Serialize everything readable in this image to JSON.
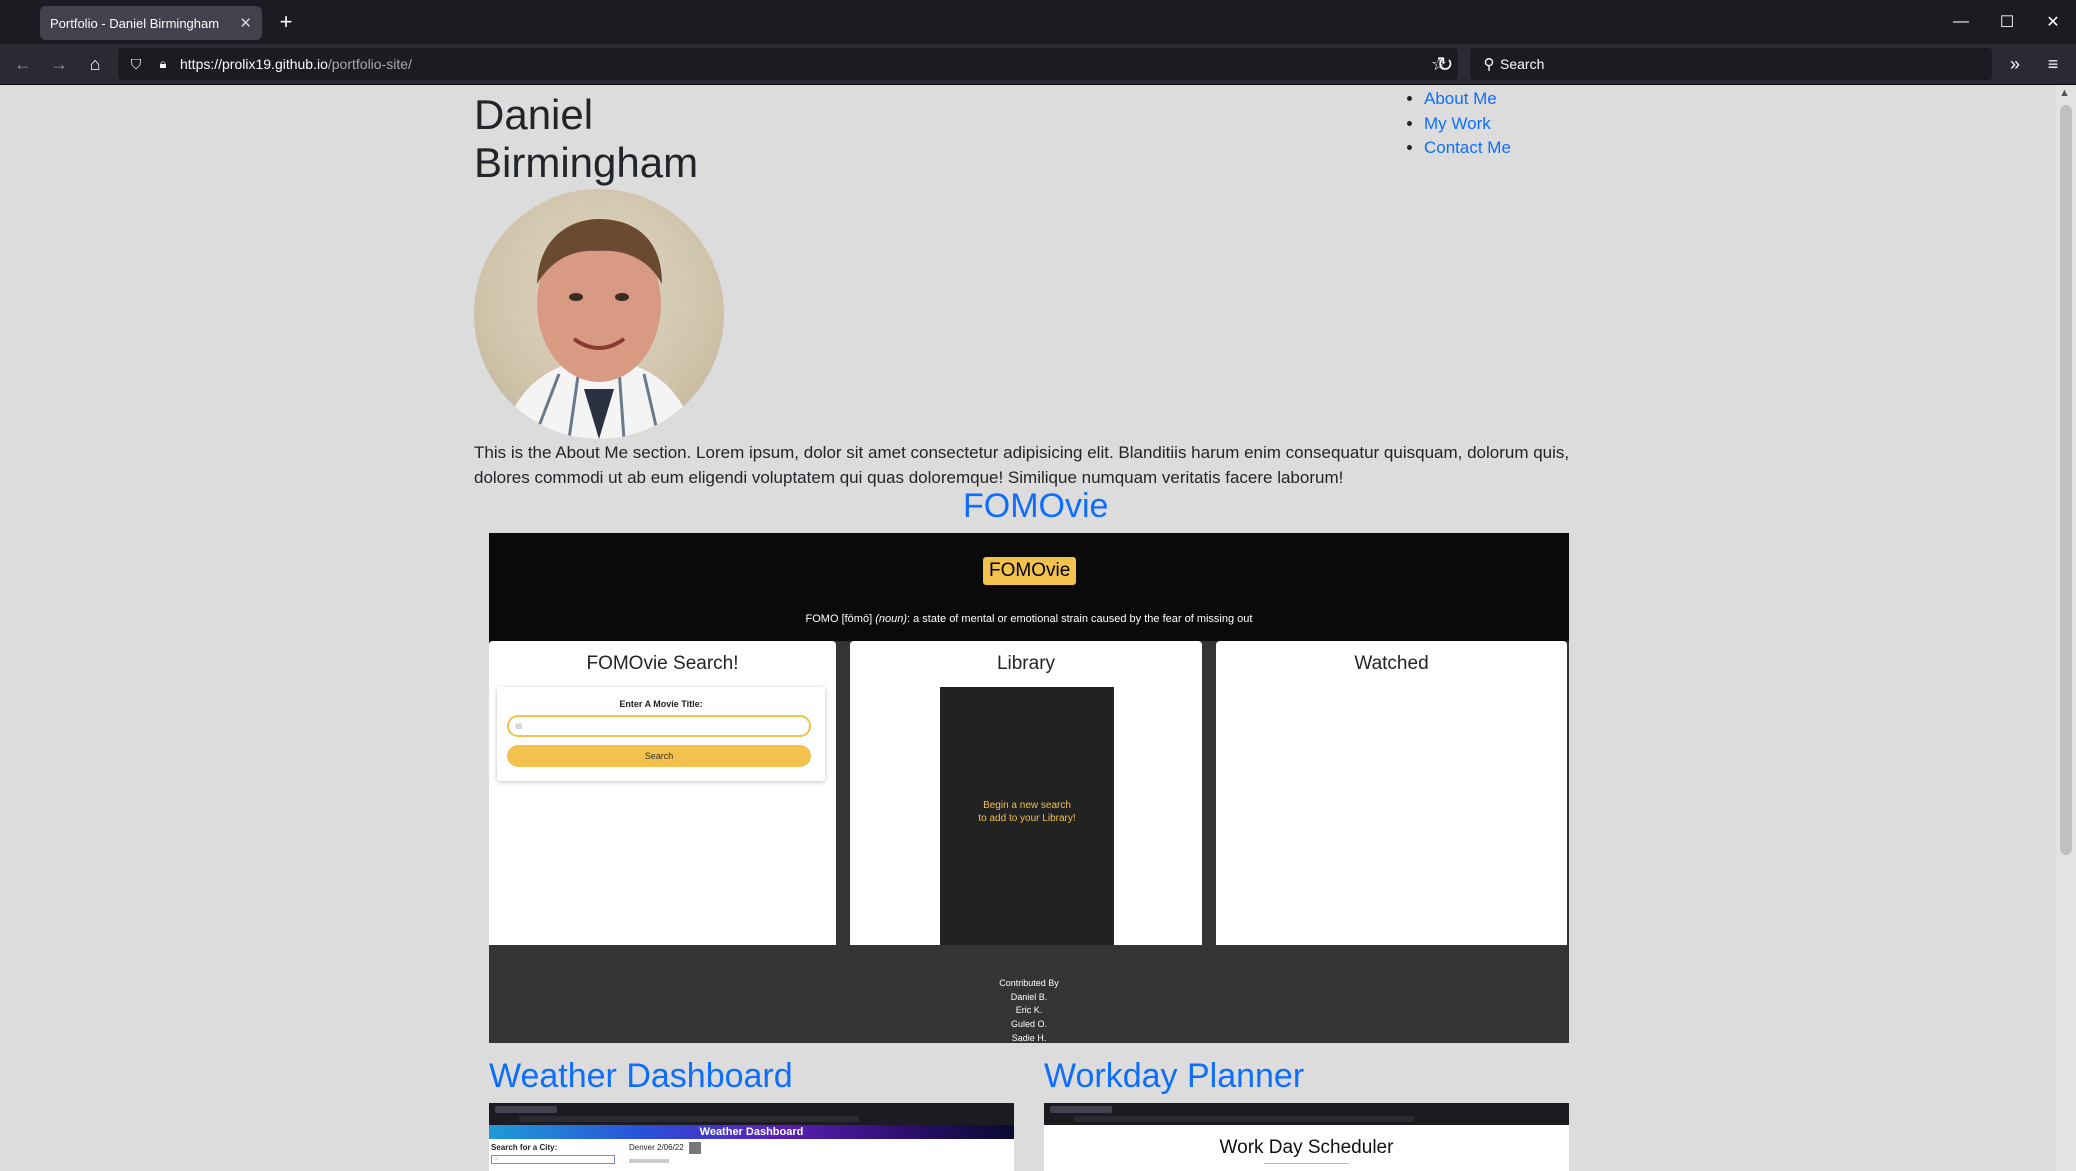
{
  "browser": {
    "tab_title": "Portfolio - Daniel Birmingham",
    "url_host": "https://prolix19.github.io",
    "url_path": "/portfolio-site/",
    "search_placeholder": "Search"
  },
  "page": {
    "name": "Daniel Birmingham",
    "nav": [
      "About Me",
      "My Work",
      "Contact Me"
    ],
    "about": "This is the About Me section. Lorem ipsum, dolor sit amet consectetur adipisicing elit. Blanditiis harum enim consequatur quisquam, dolorum quis, dolores commodi ut ab eum eligendi voluptatem qui quas doloremque! Similique numquam veritatis facere laborum!"
  },
  "projects": {
    "fomovie": {
      "title": "FOMOvie",
      "badge": "FOMOvie",
      "definition_word": "FOMO [fōmō]",
      "definition_pos": "(noun)",
      "definition_text": ": a state of mental or emotional strain caused by the fear of missing out",
      "search_heading": "FOMOvie Search!",
      "search_label": "Enter A Movie Title:",
      "search_button": "Search",
      "library_heading": "Library",
      "library_msg_1": "Begin a new search",
      "library_msg_2": "to add to your Library!",
      "watched_heading": "Watched",
      "footer": [
        "Contributed By",
        "Daniel B.",
        "Eric K.",
        "Guled O.",
        "Sadie H."
      ]
    },
    "weather": {
      "title": "Weather Dashboard",
      "banner": "Weather Dashboard",
      "search_label": "Search for a City:",
      "city": "Denver 2/06/22"
    },
    "planner": {
      "title": "Workday Planner",
      "heading": "Work Day Scheduler"
    }
  }
}
